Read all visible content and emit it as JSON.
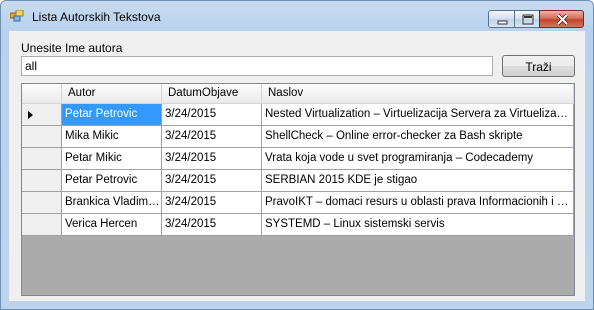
{
  "window": {
    "title": "Lista Autorskih Tekstova",
    "icons": {
      "app": "app-windows-icon",
      "minimize": "minimize-icon",
      "maximize": "maximize-icon",
      "close": "close-icon"
    }
  },
  "form": {
    "search_label": "Unesite Ime autora",
    "search_value": "all",
    "search_button": "Traži"
  },
  "grid": {
    "columns": [
      "Autor",
      "DatumObjave",
      "Naslov"
    ],
    "rows": [
      {
        "autor": "Petar Petrovic",
        "datum": "3/24/2015",
        "naslov": "Nested Virtualization – Virtuelizacija Servera za Virtuelizaciju"
      },
      {
        "autor": "Mika Mikic",
        "datum": "3/24/2015",
        "naslov": "ShellCheck – Online error-checker za Bash skripte"
      },
      {
        "autor": "Petar Mikic",
        "datum": "3/24/2015",
        "naslov": "Vrata koja vode u svet programiranja – Codecademy"
      },
      {
        "autor": "Petar Petrovic",
        "datum": "3/24/2015",
        "naslov": "SERBIAN 2015 KDE je stigao"
      },
      {
        "autor": "Brankica Vladimirović",
        "datum": "3/24/2015",
        "naslov": "PravoIKT – domaci resurs u oblasti prava Informacionih i Komunikacionih Tehnologija"
      },
      {
        "autor": "Verica Hercen",
        "datum": "3/24/2015",
        "naslov": "SYSTEMD – Linux sistemski servis"
      }
    ],
    "selected_row": 0,
    "colors": {
      "selection": "#3399ff",
      "empty_area": "#ababab"
    }
  }
}
